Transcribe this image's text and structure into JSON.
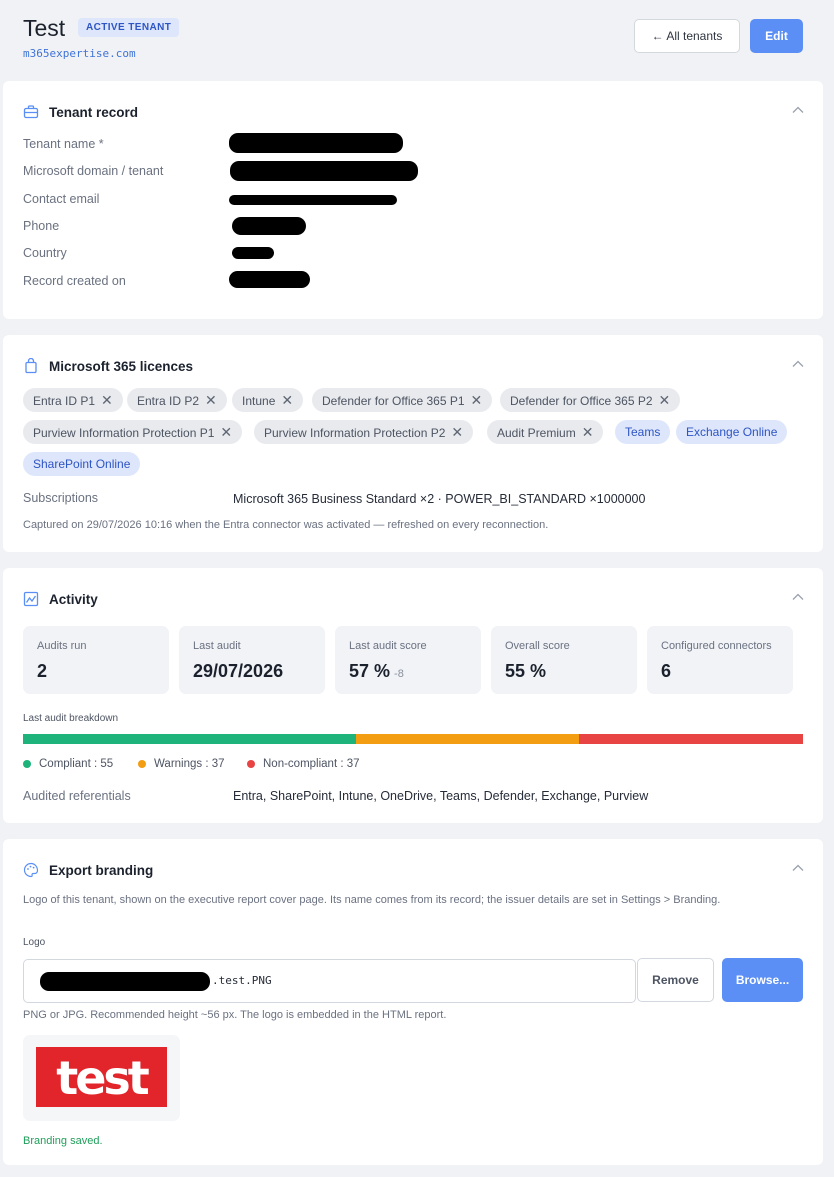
{
  "header": {
    "title": "Test",
    "badge": "ACTIVE TENANT",
    "domain": "m365expertise.com",
    "all_tenants_label": "← All tenants",
    "edit_label": "Edit"
  },
  "tenant_record": {
    "title": "Tenant record",
    "fields": [
      {
        "label": "Tenant name *"
      },
      {
        "label": "Microsoft domain / tenant"
      },
      {
        "label": "Contact email"
      },
      {
        "label": "Phone"
      },
      {
        "label": "Country"
      },
      {
        "label": "Record created on"
      }
    ]
  },
  "licences": {
    "title": "Microsoft 365 licences",
    "chips": [
      {
        "label": "Entra ID P1",
        "removable": true
      },
      {
        "label": "Entra ID P2",
        "removable": true
      },
      {
        "label": "Intune",
        "removable": true
      },
      {
        "label": "Defender for Office 365 P1",
        "removable": true
      },
      {
        "label": "Defender for Office 365 P2",
        "removable": true
      },
      {
        "label": "Purview Information Protection P1",
        "removable": true
      },
      {
        "label": "Purview Information Protection P2",
        "removable": true
      },
      {
        "label": "Audit Premium",
        "removable": true
      },
      {
        "label": "Teams",
        "removable": false
      },
      {
        "label": "Exchange Online",
        "removable": false
      },
      {
        "label": "SharePoint Online",
        "removable": false
      }
    ],
    "subscriptions_label": "Subscriptions",
    "subscriptions_value": "Microsoft 365 Business Standard ×2 · POWER_BI_STANDARD ×1000000",
    "captured_note": "Captured on 29/07/2026 10:16 when the Entra connector was activated — refreshed on every reconnection."
  },
  "activity": {
    "title": "Activity",
    "stats": [
      {
        "label": "Audits run",
        "value": "2",
        "sub": ""
      },
      {
        "label": "Last audit",
        "value": "29/07/2026",
        "sub": ""
      },
      {
        "label": "Last audit score",
        "value": "57 %",
        "sub": "-8"
      },
      {
        "label": "Overall score",
        "value": "55 %",
        "sub": ""
      },
      {
        "label": "Configured connectors",
        "value": "6",
        "sub": ""
      }
    ],
    "breakdown_label": "Last audit breakdown",
    "breakdown": [
      {
        "label": "Compliant : 55",
        "count": 55,
        "color": "#1db37a"
      },
      {
        "label": "Warnings : 37",
        "count": 37,
        "color": "#f29d12"
      },
      {
        "label": "Non-compliant : 37",
        "count": 37,
        "color": "#e84444"
      }
    ],
    "referentials_label": "Audited referentials",
    "referentials_value": "Entra, SharePoint, Intune, OneDrive, Teams, Defender, Exchange, Purview"
  },
  "branding": {
    "title": "Export branding",
    "description": "Logo of this tenant, shown on the executive report cover page. Its name comes from its record; the issuer details are set in Settings > Branding.",
    "logo_label": "Logo",
    "file_suffix": ".test.PNG",
    "remove_label": "Remove",
    "browse_label": "Browse...",
    "hint": "PNG or JPG. Recommended height ~56 px. The logo is embedded in the HTML report.",
    "logo_text": "test",
    "logo_color": "#e2242b",
    "saved_message": "Branding saved."
  },
  "colors": {
    "accent": "#5b8ff5",
    "chip_blue_bg": "#dde6fb",
    "chip_blue_text": "#2e55c4"
  }
}
